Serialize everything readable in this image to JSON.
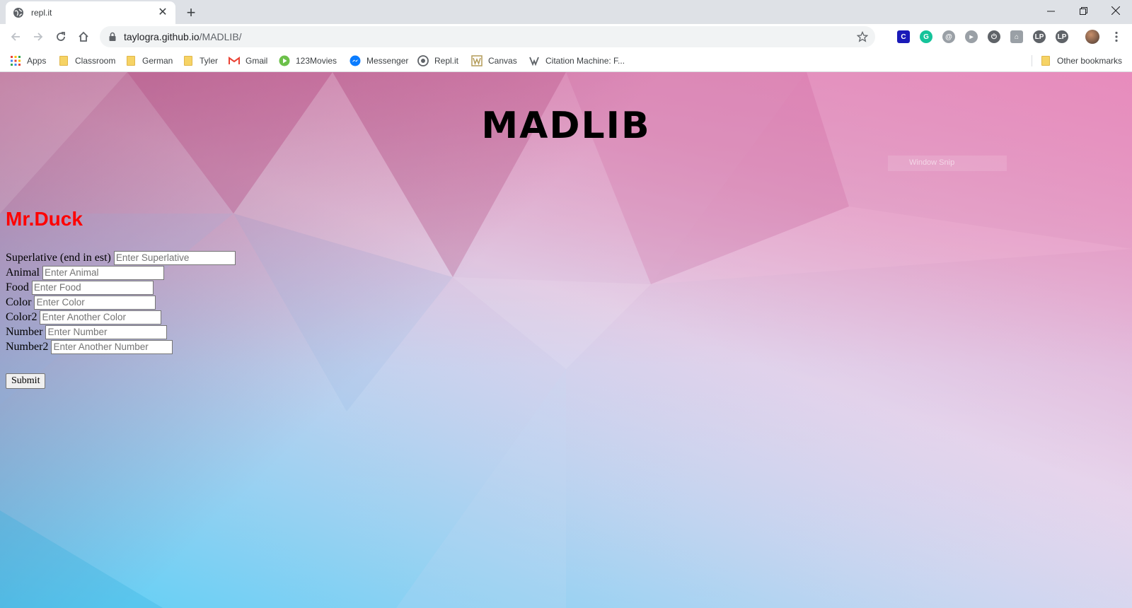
{
  "browser": {
    "tab": {
      "title": "repl.it"
    },
    "omnibox": {
      "host": "taylogra.github.io",
      "path": "/MADLIB/"
    },
    "bookmarks": [
      {
        "label": "Apps",
        "icon": "apps-grid-icon"
      },
      {
        "label": "Classroom",
        "icon": "folder-icon"
      },
      {
        "label": "German",
        "icon": "folder-icon"
      },
      {
        "label": "Tyler",
        "icon": "folder-icon"
      },
      {
        "label": "Gmail",
        "icon": "gmail-icon"
      },
      {
        "label": "123Movies",
        "icon": "play-icon"
      },
      {
        "label": "Messenger",
        "icon": "messenger-icon"
      },
      {
        "label": "Repl.it",
        "icon": "replit-icon"
      },
      {
        "label": "Canvas",
        "icon": "canvas-icon"
      },
      {
        "label": "Citation Machine: F...",
        "icon": "citation-icon"
      }
    ],
    "other_bookmarks": "Other bookmarks"
  },
  "page": {
    "title": "MADLIB",
    "overlay_text": "Window Snip",
    "name": "Mr.Duck",
    "fields": [
      {
        "label": "Superlative (end in est)",
        "placeholder": "Enter Superlative"
      },
      {
        "label": "Animal",
        "placeholder": "Enter Animal"
      },
      {
        "label": "Food",
        "placeholder": "Enter Food"
      },
      {
        "label": "Color",
        "placeholder": "Enter Color"
      },
      {
        "label": "Color2",
        "placeholder": "Enter Another Color"
      },
      {
        "label": "Number",
        "placeholder": "Enter Number"
      },
      {
        "label": "Number2",
        "placeholder": "Enter Another Number"
      }
    ],
    "submit_label": "Submit"
  },
  "colors": {
    "name": "#ff0000",
    "title": "#000000",
    "tabstrip": "#dee1e6"
  }
}
